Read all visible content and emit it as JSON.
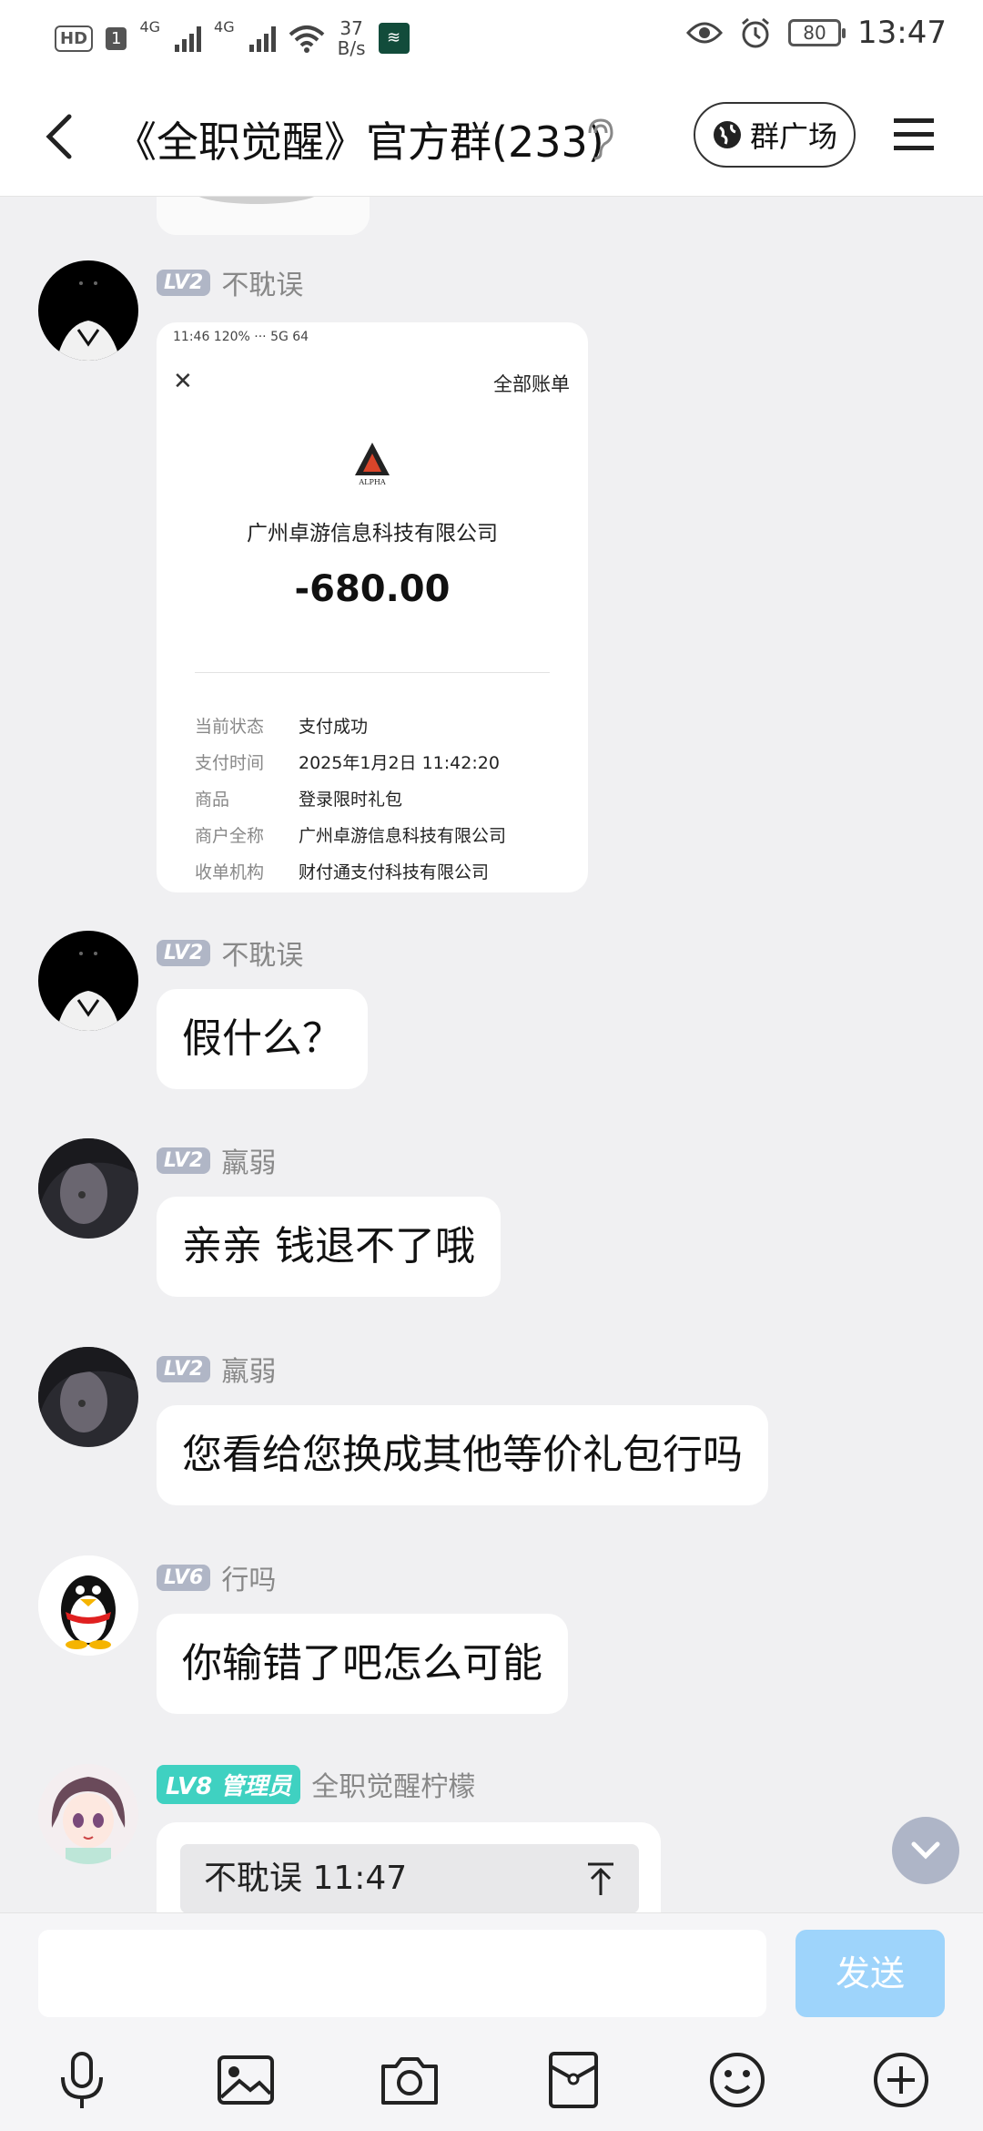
{
  "status_bar": {
    "hd": "HD",
    "sim": "1",
    "net1": "4G",
    "net2": "4G",
    "speed_value": "37",
    "speed_unit": "B/s",
    "battery": "80",
    "time": "13:47"
  },
  "header": {
    "title": "《全职觉醒》官方群(233)",
    "plaza_label": "群广场"
  },
  "receipt": {
    "status_time": "11:46 120% ··· 5G 64",
    "all_bills": "全部账单",
    "company": "广州卓游信息科技有限公司",
    "amount": "-680.00",
    "logo_text": "ALPHA",
    "rows": [
      {
        "k": "当前状态",
        "v": "支付成功"
      },
      {
        "k": "支付时间",
        "v": "2025年1月2日 11:42:20"
      },
      {
        "k": "商品",
        "v": "登录限时礼包"
      },
      {
        "k": "商户全称",
        "v": "广州卓游信息科技有限公司"
      },
      {
        "k": "收单机构",
        "v": "财付通支付科技有限公司"
      }
    ]
  },
  "messages": [
    {
      "level": "LV2",
      "name": "不耽误",
      "text": ""
    },
    {
      "level": "LV2",
      "name": "不耽误",
      "text": "假什么？"
    },
    {
      "level": "LV2",
      "name": "羸弱",
      "text": "亲亲  钱退不了哦"
    },
    {
      "level": "LV2",
      "name": "羸弱",
      "text": "您看给您换成其他等价礼包行吗"
    },
    {
      "level": "LV6",
      "name": "行吗",
      "text": "你输错了吧怎么可能"
    },
    {
      "level": "LV8",
      "role": "管理员",
      "name": "全职觉醒柠檬",
      "quote": "不耽误 11:47"
    }
  ],
  "input": {
    "placeholder": "",
    "send_label": "发送"
  },
  "colors": {
    "accent": "#3fd1c1",
    "send_disabled": "#9ed4fb",
    "level_badge": "#b0b6c6"
  },
  "icons": [
    "back-icon",
    "ear-icon",
    "globe-icon",
    "menu-icon",
    "mic-icon",
    "image-icon",
    "camera-icon",
    "red-packet-icon",
    "emoji-icon",
    "plus-icon",
    "chevron-down-icon"
  ]
}
